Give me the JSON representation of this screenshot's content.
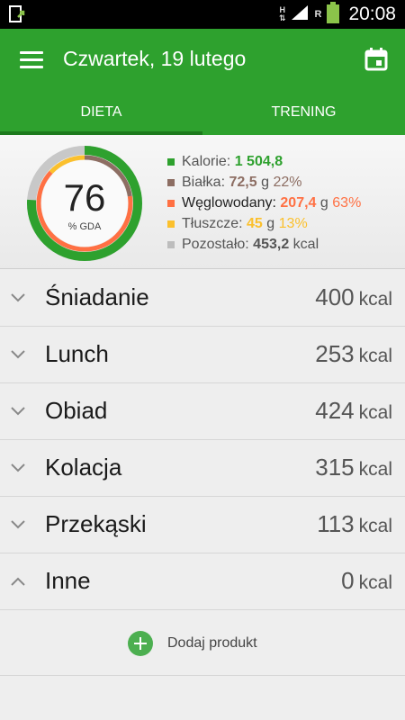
{
  "status_bar": {
    "time": "20:08",
    "network_label_top": "H",
    "network_label_bottom": "R",
    "icons": [
      "file-upload-icon",
      "data-transfer-icon",
      "signal-icon",
      "battery-icon"
    ]
  },
  "app_bar": {
    "title": "Czwartek, 19 lutego",
    "icons": [
      "menu-icon",
      "calendar-icon"
    ],
    "color": "#2ea12e"
  },
  "tabs": [
    {
      "label": "DIETA",
      "active": true
    },
    {
      "label": "TRENING",
      "active": false
    }
  ],
  "summary": {
    "gda_value": "76",
    "gda_label": "% GDA",
    "ring_fraction": 0.76,
    "legend": [
      {
        "label": "Kalorie:",
        "value": "1 504,8",
        "unit": "",
        "percent": "",
        "color": "#2ea12e"
      },
      {
        "label": "Białka:",
        "value": "72,5",
        "unit": "g",
        "percent": "22%",
        "color": "#8d6e63"
      },
      {
        "label": "Węglowodany:",
        "value": "207,4",
        "unit": "g",
        "percent": "63%",
        "color": "#ff7043"
      },
      {
        "label": "Tłuszcze:",
        "value": "45",
        "unit": "g",
        "percent": "13%",
        "color": "#fbc02d"
      },
      {
        "label": "Pozostało:",
        "value": "453,2",
        "unit": "kcal",
        "percent": "",
        "color": "#bdbdbd"
      }
    ]
  },
  "meals": [
    {
      "name": "Śniadanie",
      "kcal": "400",
      "unit": "kcal",
      "expanded": false
    },
    {
      "name": "Lunch",
      "kcal": "253",
      "unit": "kcal",
      "expanded": false
    },
    {
      "name": "Obiad",
      "kcal": "424",
      "unit": "kcal",
      "expanded": false
    },
    {
      "name": "Kolacja",
      "kcal": "315",
      "unit": "kcal",
      "expanded": false
    },
    {
      "name": "Przekąski",
      "kcal": "113",
      "unit": "kcal",
      "expanded": false
    },
    {
      "name": "Inne",
      "kcal": "0",
      "unit": "kcal",
      "expanded": true
    }
  ],
  "add_product": {
    "label": "Dodaj produkt",
    "icon": "plus-circle-icon"
  }
}
